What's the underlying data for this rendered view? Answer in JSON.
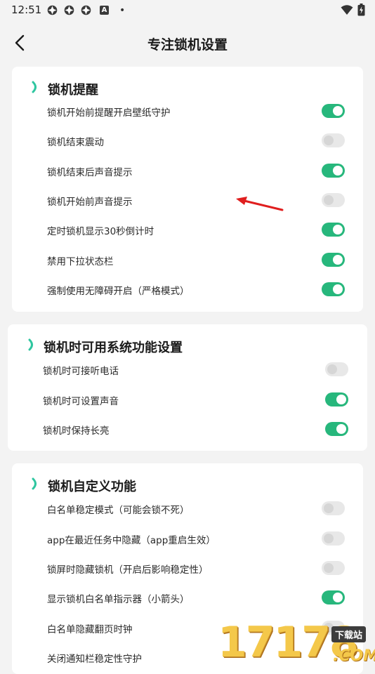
{
  "status_bar": {
    "time": "12:51",
    "notif_letter": "A",
    "dot": "•"
  },
  "header": {
    "title": "专注锁机设置"
  },
  "sections": [
    {
      "title": "锁机提醒",
      "rows": [
        {
          "label": "锁机开始前提醒开启壁纸守护",
          "on": true
        },
        {
          "label": "锁机结束震动",
          "on": false
        },
        {
          "label": "锁机结束后声音提示",
          "on": true
        },
        {
          "label": "锁机开始前声音提示",
          "on": false
        },
        {
          "label": "定时锁机显示30秒倒计时",
          "on": true
        },
        {
          "label": "禁用下拉状态栏",
          "on": true
        },
        {
          "label": "强制使用无障碍开启（严格模式）",
          "on": true
        }
      ]
    },
    {
      "title": "锁机时可用系统功能设置",
      "rows": [
        {
          "label": "锁机时可接听电话",
          "on": false
        },
        {
          "label": "锁机时可设置声音",
          "on": true
        },
        {
          "label": "锁机时保持长亮",
          "on": true
        }
      ]
    },
    {
      "title": "锁机自定义功能",
      "rows": [
        {
          "label": "白名单稳定模式（可能会锁不死）",
          "on": false
        },
        {
          "label": "app在最近任务中隐藏（app重启生效）",
          "on": false
        },
        {
          "label": "锁屏时隐藏锁机（开启后影响稳定性）",
          "on": false
        },
        {
          "label": "显示锁机白名单指示器（小箭头）",
          "on": true
        },
        {
          "label": "白名单隐藏翻页时钟",
          "on": false
        },
        {
          "label": "关闭通知栏稳定性守护",
          "on": false
        }
      ]
    }
  ],
  "colors": {
    "toggle_on": "#27b77c",
    "toggle_off": "#e8e8e8",
    "accent_mark": "#2fc6a0",
    "arrow": "#e01e1e"
  },
  "watermark": {
    "digits": "17178",
    "tag": "下载站",
    "com": ".COM"
  }
}
